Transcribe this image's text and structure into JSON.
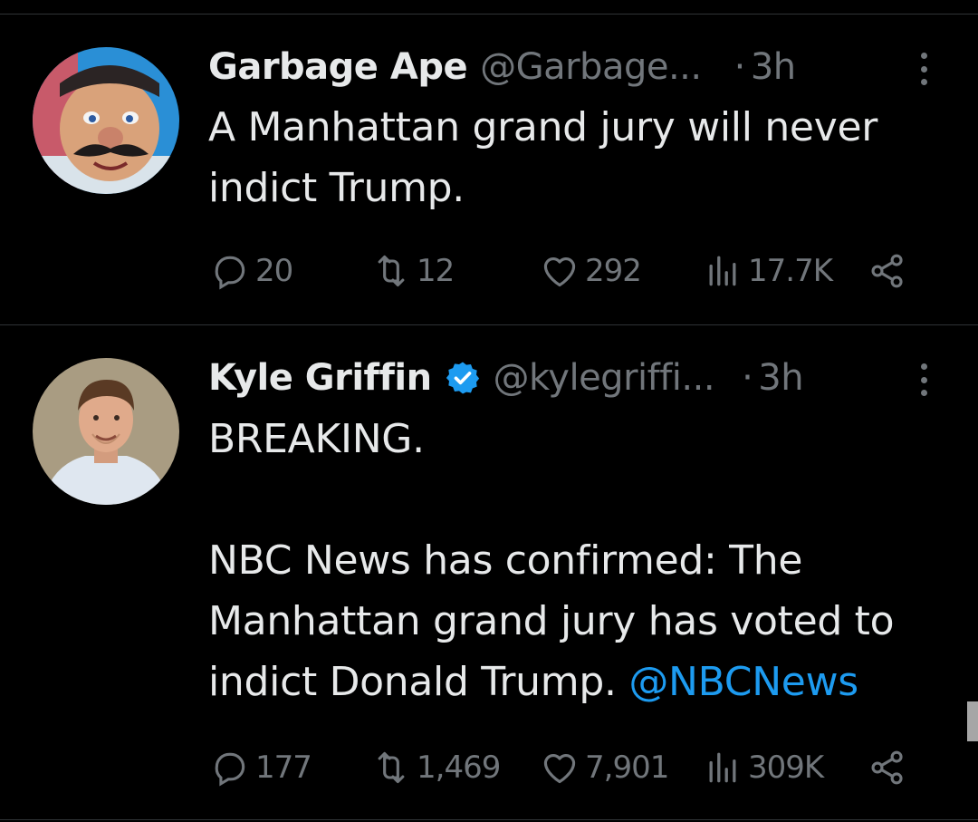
{
  "tweets": [
    {
      "name": "Garbage Ape",
      "handle": "@Garbage...",
      "dot": "·",
      "time": "3h",
      "verified": false,
      "avatar": "garbage-ape-avatar",
      "text_lines": [
        "A Manhattan grand jury will never",
        "indict Trump."
      ],
      "stats": {
        "replies": "20",
        "reposts": "12",
        "likes": "292",
        "views": "17.7K"
      }
    },
    {
      "name": "Kyle Griffin",
      "handle": "@kylegriffi...",
      "dot": "·",
      "time": "3h",
      "verified": true,
      "avatar": "kyle-griffin-avatar",
      "text_line1": "BREAKING.",
      "text_line2": "NBC News has confirmed: The",
      "text_line3": "Manhattan grand jury has voted to",
      "text_line4_prefix": "indict Donald Trump.",
      "mention": "@NBCNews",
      "stats": {
        "replies": "177",
        "reposts": "1,469",
        "likes": "7,901",
        "views": "309K"
      }
    }
  ],
  "colors": {
    "background": "#000000",
    "text": "#e7e9ea",
    "secondary": "#71767b",
    "accent": "#1d9bf0",
    "divider": "#2f3336"
  },
  "icons": {
    "reply": "reply-icon",
    "repost": "repost-icon",
    "like": "heart-icon",
    "views": "views-icon",
    "share": "share-icon",
    "more": "more-icon",
    "verified": "verified-badge-icon"
  }
}
